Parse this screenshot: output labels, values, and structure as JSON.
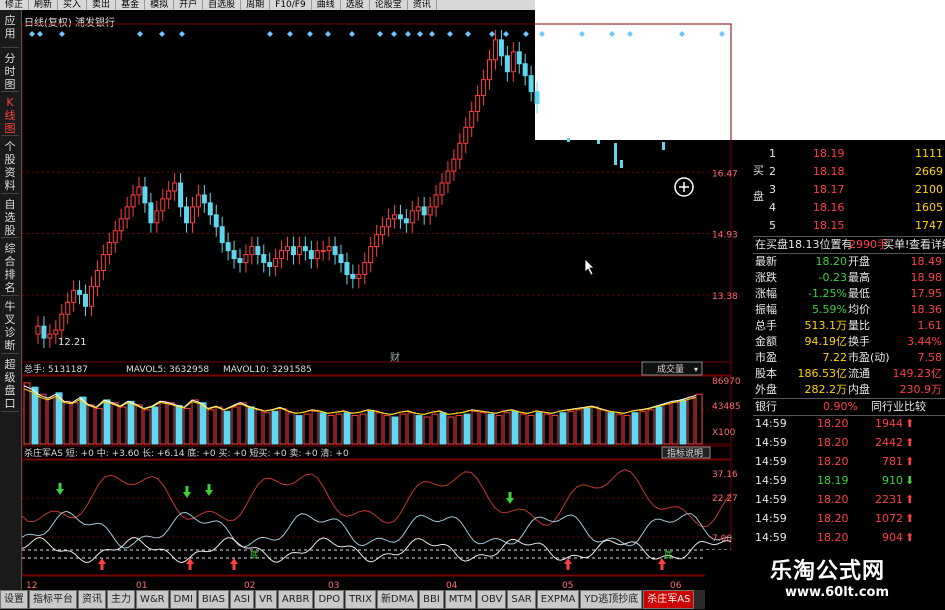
{
  "toolbar": {
    "items": [
      "修正",
      "刷新",
      "买入",
      "卖出",
      "基金",
      "模拟",
      "开户",
      "自选股",
      "周期",
      "F10/F9",
      "曲线",
      "选股",
      "论股堂",
      "资讯"
    ]
  },
  "sidebar": {
    "tabs": [
      "应用",
      "分时图",
      "K线图",
      "个股资料",
      "自选股",
      "综合排名",
      "牛叉诊断",
      "超级盘口"
    ]
  },
  "chart": {
    "title": "日线(复权) 浦发银行",
    "price_ticks": [
      "16.47",
      "14.93",
      "13.38"
    ],
    "low_label": "12.21",
    "event_label": "财",
    "vol_header": {
      "total": "总手: 5131187",
      "mavol5": "MAVOL5: 3632958",
      "mavol10": "MAVOL10: 3291585"
    },
    "vol_dropdown": "成交量",
    "vol_ticks": [
      "86970",
      "43485",
      "X100"
    ],
    "ind_header": "杀庄军AS 短: +0  中: +3.60  长: +6.14  底: +0  买: +0  短买: +0  卖: +0  清: +0",
    "ind_button": "指标说明",
    "ind_ticks": [
      "37.16",
      "22.27",
      "7.00"
    ],
    "ind_marks": [
      "底",
      "底"
    ],
    "months": [
      "12",
      "01",
      "02",
      "03",
      "04",
      "05",
      "06"
    ]
  },
  "chart_data": {
    "type": "candlestick",
    "ytick_labels": [
      "16.47",
      "14.93",
      "13.38"
    ],
    "low_label": "12.21",
    "months": [
      "12",
      "01",
      "02",
      "03",
      "04",
      "05",
      "06"
    ],
    "close_series": [
      12.6,
      12.3,
      12.4,
      12.5,
      12.9,
      13.2,
      13.5,
      13.4,
      13.1,
      13.6,
      14.0,
      14.4,
      14.7,
      15.0,
      15.3,
      15.6,
      15.9,
      16.1,
      15.7,
      15.2,
      15.5,
      15.8,
      16.0,
      16.2,
      15.6,
      15.2,
      15.6,
      15.9,
      15.7,
      15.4,
      15.1,
      14.7,
      14.5,
      14.3,
      14.2,
      14.4,
      14.6,
      14.4,
      14.2,
      14.1,
      14.3,
      14.5,
      14.6,
      14.4,
      14.6,
      14.5,
      14.3,
      14.5,
      14.5,
      14.6,
      14.4,
      14.2,
      13.9,
      13.8,
      13.9,
      14.2,
      14.6,
      14.9,
      15.1,
      15.3,
      15.4,
      15.3,
      15.2,
      15.5,
      15.6,
      15.4,
      15.6,
      15.9,
      16.2,
      16.5,
      16.8,
      17.2,
      17.6,
      18.0,
      18.4,
      18.8,
      19.3,
      19.8,
      19.4,
      19.0,
      19.5,
      19.2,
      18.9,
      18.5,
      18.2
    ],
    "volume_series": [
      86,
      80,
      70,
      65,
      72,
      60,
      58,
      66,
      55,
      50,
      62,
      58,
      52,
      60,
      55,
      48,
      52,
      60,
      58,
      54,
      50,
      62,
      58,
      48,
      52,
      46,
      52,
      58,
      52,
      48,
      44,
      46,
      50,
      44,
      40,
      42,
      46,
      44,
      40,
      42,
      44,
      40,
      42,
      46,
      44,
      40,
      38,
      42,
      44,
      40,
      38,
      42,
      44,
      38,
      40,
      42,
      46,
      44,
      42,
      40,
      44,
      46,
      42,
      40,
      44,
      42,
      40,
      44,
      46,
      48,
      50,
      52,
      48,
      44,
      42,
      40,
      44,
      46,
      48,
      52,
      56,
      60,
      62,
      66,
      70
    ]
  },
  "quote": {
    "buy_side": "买盘",
    "bids": [
      {
        "n": "1",
        "price": "18.19",
        "vol": "1111"
      },
      {
        "n": "2",
        "price": "18.18",
        "vol": "2669"
      },
      {
        "n": "3",
        "price": "18.17",
        "vol": "2100"
      },
      {
        "n": "4",
        "price": "18.16",
        "vol": "1605"
      },
      {
        "n": "5",
        "price": "18.15",
        "vol": "1747"
      }
    ],
    "notice": {
      "text": "在买盘18.13位置有",
      "amount": "2990手",
      "buy": "买单!",
      "detail": "查看详细"
    },
    "stats": [
      {
        "l1": "最新",
        "v1": "18.20",
        "l2": "开盘",
        "v2": "18.49"
      },
      {
        "l1": "涨跌",
        "v1": "-0.23",
        "l2": "最高",
        "v2": "18.98"
      },
      {
        "l1": "涨幅",
        "v1": "-1.25%",
        "l2": "最低",
        "v2": "17.95"
      },
      {
        "l1": "振幅",
        "v1": "5.59%",
        "l2": "均价",
        "v2": "18.36"
      },
      {
        "l1": "总手",
        "v1": "513.1万",
        "l2": "量比",
        "v2": "1.61"
      },
      {
        "l1": "金额",
        "v1": "94.19亿",
        "l2": "换手",
        "v2": "3.44%"
      },
      {
        "l1": "市盈",
        "v1": "7.22",
        "l2": "市盈(动)",
        "v2": "7.58"
      },
      {
        "l1": "股本",
        "v1": "186.53亿",
        "l2": "流通",
        "v2": "149.23亿"
      },
      {
        "l1": "外盘",
        "v1": "282.2万",
        "l2": "内盘",
        "v2": "230.9万"
      }
    ],
    "industry": {
      "name": "银行",
      "pct": "0.90%",
      "compare": "同行业比较"
    },
    "ticks": [
      {
        "t": "14:59",
        "p": "18.20",
        "v": "1944",
        "dir": "up"
      },
      {
        "t": "14:59",
        "p": "18.20",
        "v": "2442",
        "dir": "up"
      },
      {
        "t": "14:59",
        "p": "18.20",
        "v": "781",
        "dir": "up"
      },
      {
        "t": "14:59",
        "p": "18.19",
        "v": "910",
        "dir": "down"
      },
      {
        "t": "14:59",
        "p": "18.20",
        "v": "2231",
        "dir": "up"
      },
      {
        "t": "14:59",
        "p": "18.20",
        "v": "1072",
        "dir": "up"
      },
      {
        "t": "14:59",
        "p": "18.20",
        "v": "904",
        "dir": "up"
      }
    ]
  },
  "bottom_tabs": [
    "设置",
    "指标平台",
    "资讯",
    "主力",
    "W&R",
    "DMI",
    "BIAS",
    "ASI",
    "VR",
    "ARBR",
    "DPO",
    "TRIX",
    "新DMA",
    "BBI",
    "MTM",
    "OBV",
    "SAR",
    "EXPMA",
    "YD逃顶抄底",
    "杀庄军AS"
  ],
  "watermark": {
    "title": "乐淘公式网",
    "url": "www.60lt.com"
  },
  "colors": {
    "up": "#ff4040",
    "down": "#5fd7ee",
    "grid": "#7a0000",
    "green": "#3cd23c",
    "yellow": "#ffd400"
  }
}
